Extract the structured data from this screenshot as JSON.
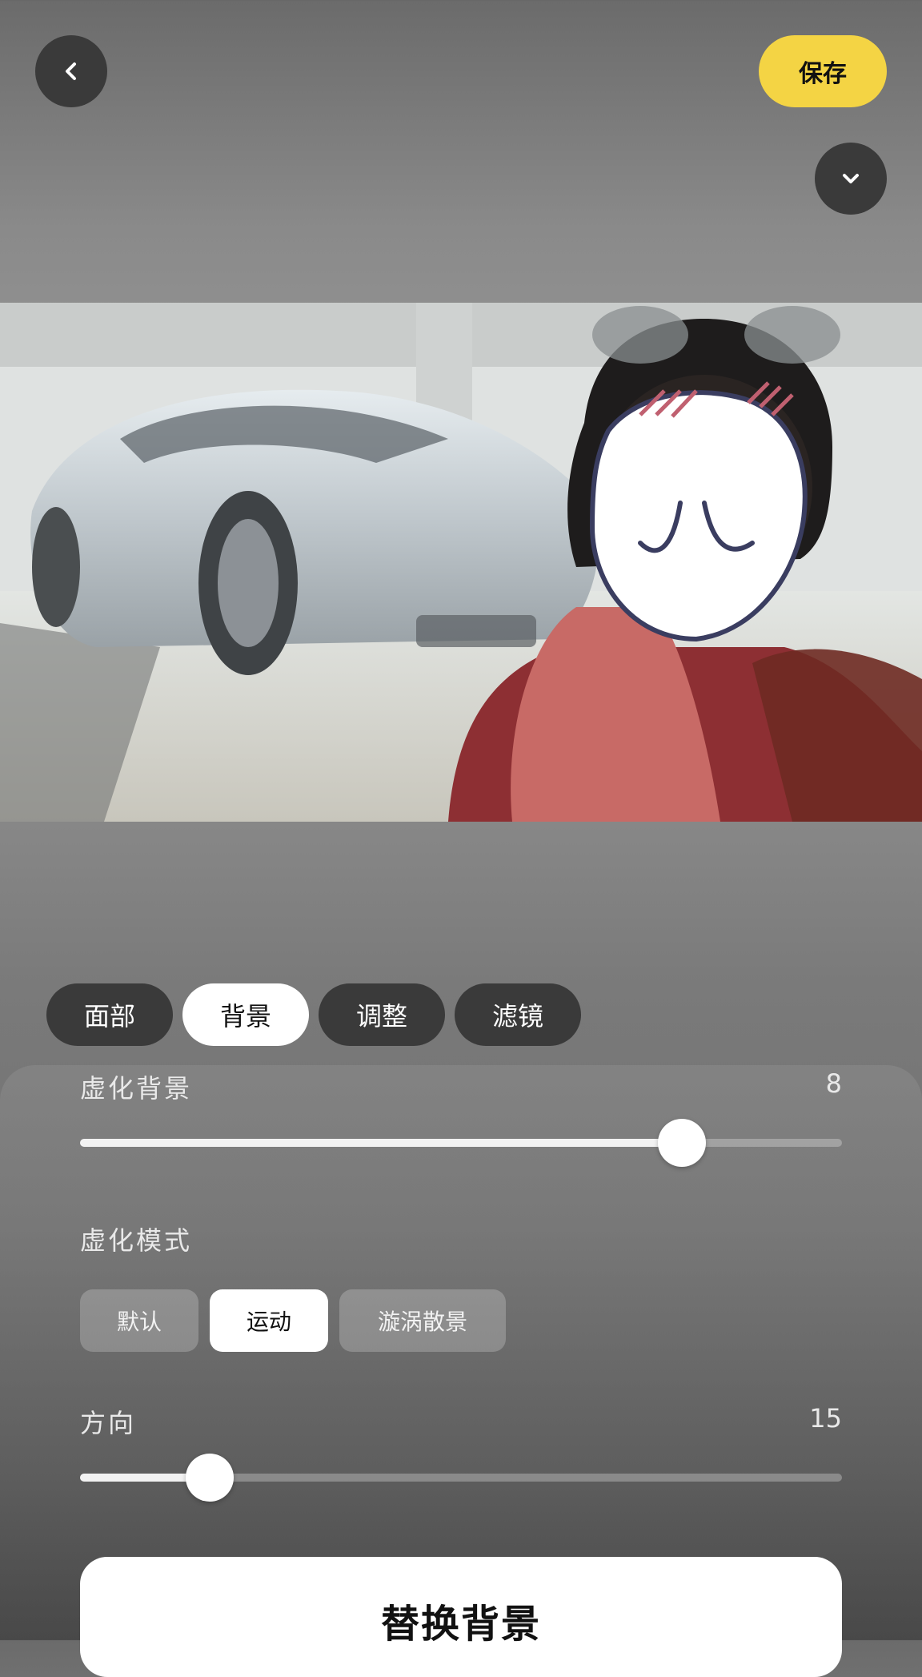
{
  "header": {
    "back_icon": "chevron-left-icon",
    "save_label": "保存",
    "collapse_icon": "chevron-down-icon",
    "accent_color": "#f4d444"
  },
  "photo": {
    "subject": "photo"
  },
  "tabs": [
    {
      "label": "面部",
      "active": false
    },
    {
      "label": "背景",
      "active": true
    },
    {
      "label": "调整",
      "active": false
    },
    {
      "label": "滤镜",
      "active": false
    }
  ],
  "blur": {
    "label": "虚化背景",
    "value": "8",
    "level": 0.79
  },
  "mode": {
    "label": "虚化模式",
    "options": [
      {
        "label": "默认",
        "active": false
      },
      {
        "label": "运动",
        "active": true
      },
      {
        "label": "漩涡散景",
        "active": false
      }
    ]
  },
  "direction": {
    "label": "方向",
    "value": "15",
    "level": 0.17
  },
  "replace_button": {
    "label": "替换背景"
  }
}
